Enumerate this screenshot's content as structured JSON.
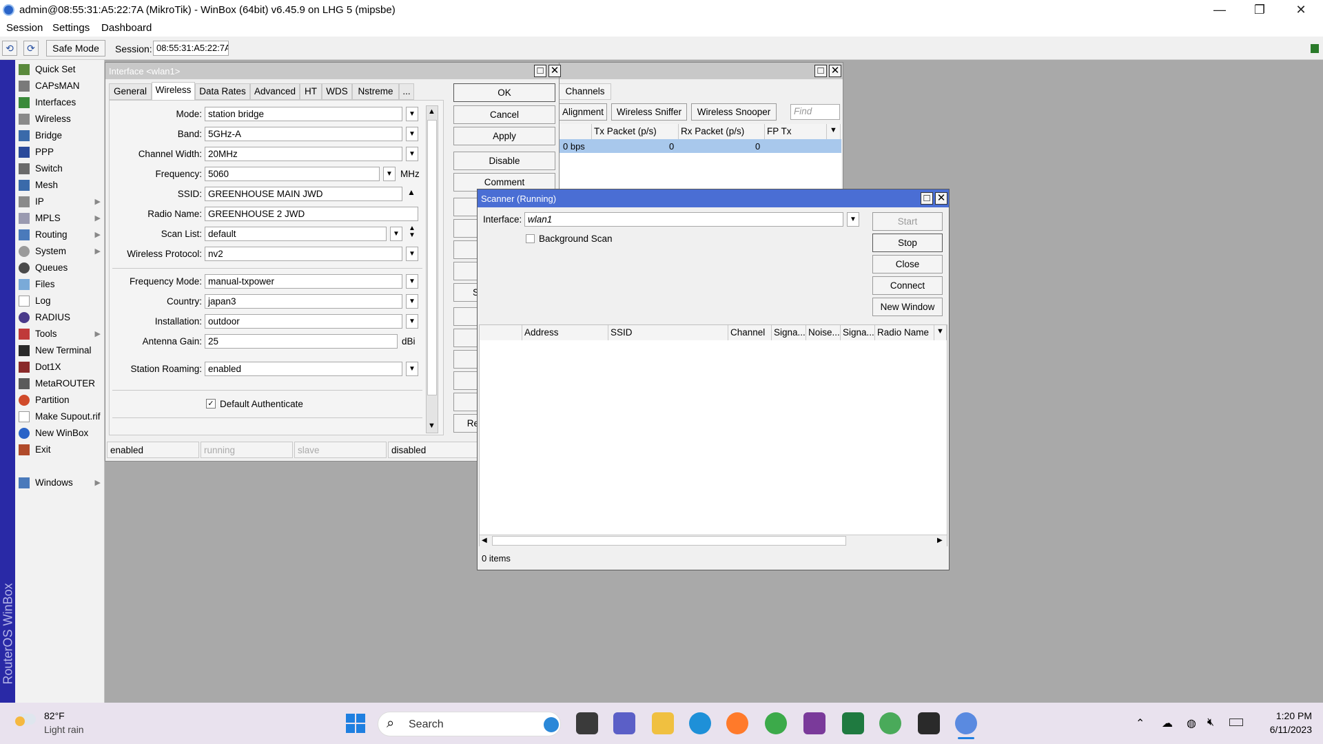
{
  "window": {
    "title": "admin@08:55:31:A5:22:7A (MikroTik) - WinBox (64bit) v6.45.9 on LHG 5 (mipsbe)",
    "controls": {
      "minimize": "—",
      "restore": "❐",
      "close": "✕"
    }
  },
  "menubar": [
    "Session",
    "Settings",
    "Dashboard"
  ],
  "toolbar": {
    "undo": "⟲",
    "redo": "⟳",
    "safe_mode": "Safe Mode",
    "session_label": "Session:",
    "session_value": "08:55:31:A5:22:7A"
  },
  "brand_text": "RouterOS WinBox",
  "sidebar": [
    {
      "label": "Quick Set",
      "icon": "quick-set-icon",
      "submenu": false
    },
    {
      "label": "CAPsMAN",
      "icon": "capsman-icon",
      "submenu": false
    },
    {
      "label": "Interfaces",
      "icon": "interfaces-icon",
      "submenu": false
    },
    {
      "label": "Wireless",
      "icon": "wireless-icon",
      "submenu": false
    },
    {
      "label": "Bridge",
      "icon": "bridge-icon",
      "submenu": false
    },
    {
      "label": "PPP",
      "icon": "ppp-icon",
      "submenu": false
    },
    {
      "label": "Switch",
      "icon": "switch-icon",
      "submenu": false
    },
    {
      "label": "Mesh",
      "icon": "mesh-icon",
      "submenu": false
    },
    {
      "label": "IP",
      "icon": "ip-icon",
      "submenu": true
    },
    {
      "label": "MPLS",
      "icon": "mpls-icon",
      "submenu": true
    },
    {
      "label": "Routing",
      "icon": "routing-icon",
      "submenu": true
    },
    {
      "label": "System",
      "icon": "system-icon",
      "submenu": true
    },
    {
      "label": "Queues",
      "icon": "queues-icon",
      "submenu": false
    },
    {
      "label": "Files",
      "icon": "files-icon",
      "submenu": false
    },
    {
      "label": "Log",
      "icon": "log-icon",
      "submenu": false
    },
    {
      "label": "RADIUS",
      "icon": "radius-icon",
      "submenu": false
    },
    {
      "label": "Tools",
      "icon": "tools-icon",
      "submenu": true
    },
    {
      "label": "New Terminal",
      "icon": "terminal-icon",
      "submenu": false
    },
    {
      "label": "Dot1X",
      "icon": "dot1x-icon",
      "submenu": false
    },
    {
      "label": "MetaROUTER",
      "icon": "metarouter-icon",
      "submenu": false
    },
    {
      "label": "Partition",
      "icon": "partition-icon",
      "submenu": false
    },
    {
      "label": "Make Supout.rif",
      "icon": "supout-icon",
      "submenu": false
    },
    {
      "label": "New WinBox",
      "icon": "new-winbox-icon",
      "submenu": false
    },
    {
      "label": "Exit",
      "icon": "exit-icon",
      "submenu": false
    }
  ],
  "sidebar_windows": {
    "label": "Windows",
    "icon": "windows-icon"
  },
  "interface_window": {
    "title": "Interface <wlan1>",
    "tabs": [
      "General",
      "Wireless",
      "Data Rates",
      "Advanced",
      "HT",
      "WDS",
      "Nstreme",
      "..."
    ],
    "active_tab": "Wireless",
    "fields": {
      "mode": {
        "label": "Mode:",
        "value": "station bridge"
      },
      "band": {
        "label": "Band:",
        "value": "5GHz-A"
      },
      "channel_width": {
        "label": "Channel Width:",
        "value": "20MHz"
      },
      "frequency": {
        "label": "Frequency:",
        "value": "5060",
        "unit": "MHz"
      },
      "ssid": {
        "label": "SSID:",
        "value": "GREENHOUSE MAIN JWD"
      },
      "radio_name": {
        "label": "Radio Name:",
        "value": "GREENHOUSE 2 JWD"
      },
      "scan_list": {
        "label": "Scan List:",
        "value": "default"
      },
      "wireless_protocol": {
        "label": "Wireless Protocol:",
        "value": "nv2"
      },
      "frequency_mode": {
        "label": "Frequency Mode:",
        "value": "manual-txpower"
      },
      "country": {
        "label": "Country:",
        "value": "japan3"
      },
      "installation": {
        "label": "Installation:",
        "value": "outdoor"
      },
      "antenna_gain": {
        "label": "Antenna Gain:",
        "value": "25",
        "unit": "dBi"
      },
      "station_roaming": {
        "label": "Station Roaming:",
        "value": "enabled"
      }
    },
    "default_authenticate": {
      "label": "Default Authenticate",
      "checked": true
    },
    "buttons": {
      "ok": "OK",
      "cancel": "Cancel",
      "apply": "Apply",
      "disable": "Disable",
      "comment": "Comment",
      "s_partial": "S",
      "re_partial": "Re"
    },
    "status": [
      "enabled",
      "running",
      "slave",
      "disabled"
    ]
  },
  "wireless_window": {
    "tabs": [
      "Channels"
    ],
    "buttons": [
      "Alignment",
      "Wireless Sniffer",
      "Wireless Snooper"
    ],
    "find_placeholder": "Find",
    "columns": [
      "Tx Packet (p/s)",
      "Rx Packet (p/s)",
      "FP Tx"
    ],
    "row": {
      "rate": "0 bps",
      "tx": "0",
      "rx": "0"
    }
  },
  "scanner_window": {
    "title": "Scanner (Running)",
    "interface_label": "Interface:",
    "interface_value": "wlan1",
    "background_scan": "Background Scan",
    "buttons": {
      "start": "Start",
      "stop": "Stop",
      "close": "Close",
      "connect": "Connect",
      "new_window": "New Window"
    },
    "columns": [
      "Address",
      "SSID",
      "Channel",
      "Signa...",
      "Noise...",
      "Signa...",
      "Radio Name"
    ],
    "item_count": "0 items"
  },
  "taskbar": {
    "weather_temp": "82°F",
    "weather_desc": "Light rain",
    "search_label": "Search",
    "time": "1:20 PM",
    "date": "6/11/2023"
  }
}
